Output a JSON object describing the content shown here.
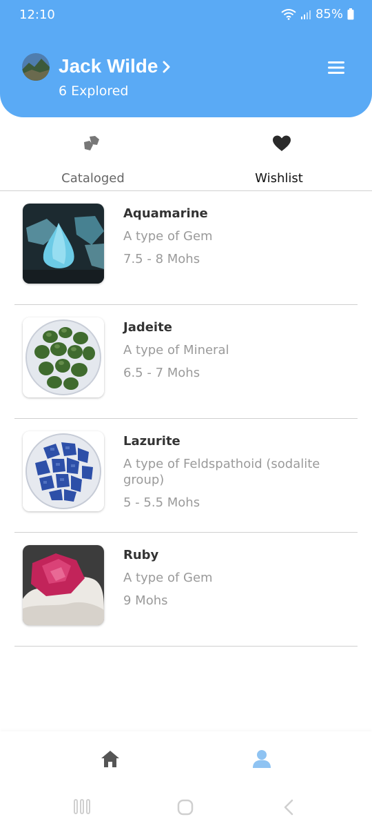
{
  "status": {
    "time": "12:10",
    "battery": "85%"
  },
  "header": {
    "user_name": "Jack Wilde",
    "explored": "6 Explored"
  },
  "tabs": [
    {
      "label": "Cataloged",
      "icon": "stones-icon"
    },
    {
      "label": "Wishlist",
      "icon": "heart-icon"
    }
  ],
  "items": [
    {
      "name": "Aquamarine",
      "type": "A type of Gem",
      "hardness": "7.5 - 8 Mohs"
    },
    {
      "name": "Jadeite",
      "type": "A type of Mineral",
      "hardness": "6.5 - 7 Mohs"
    },
    {
      "name": "Lazurite",
      "type": "A type of Feldspathoid (sodalite group)",
      "hardness": "5 - 5.5 Mohs"
    },
    {
      "name": "Ruby",
      "type": "A type of Gem",
      "hardness": "9 Mohs"
    }
  ],
  "colors": {
    "header": "#5aaaf5",
    "active_nav": "#8fc3f2",
    "inactive_nav": "#555555"
  }
}
